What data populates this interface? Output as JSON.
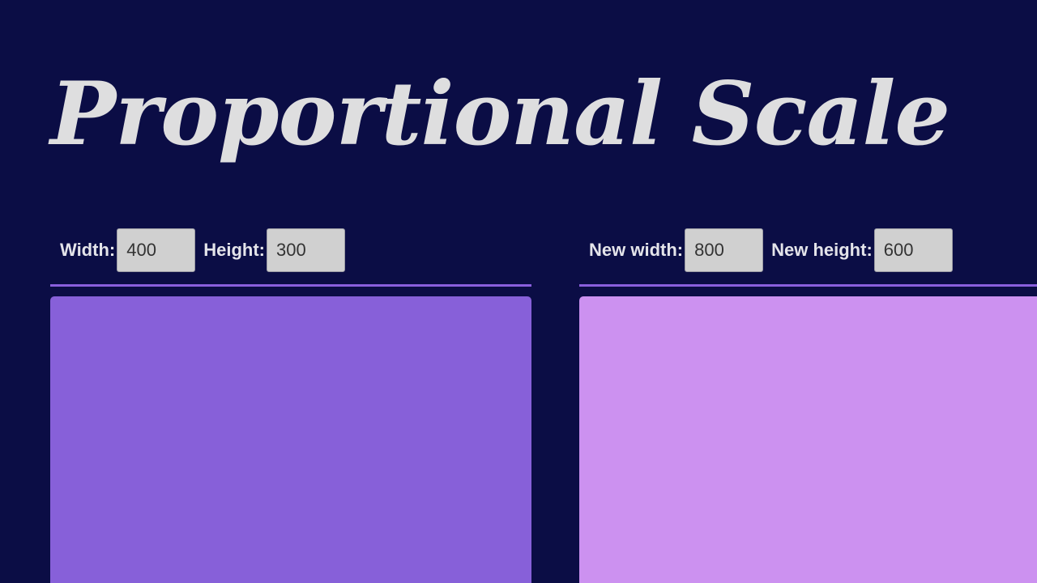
{
  "title": "Proportional Scale",
  "original": {
    "width_label": "Width:",
    "width_value": "400",
    "height_label": "Height:",
    "height_value": "300"
  },
  "scaled": {
    "width_label": "New width:",
    "width_value": "800",
    "height_label": "New height:",
    "height_value": "600"
  },
  "colors": {
    "background": "#0b0d45",
    "accent": "#8a5fdd",
    "original_box": "#8760d9",
    "scaled_box": "#cc91f0"
  }
}
